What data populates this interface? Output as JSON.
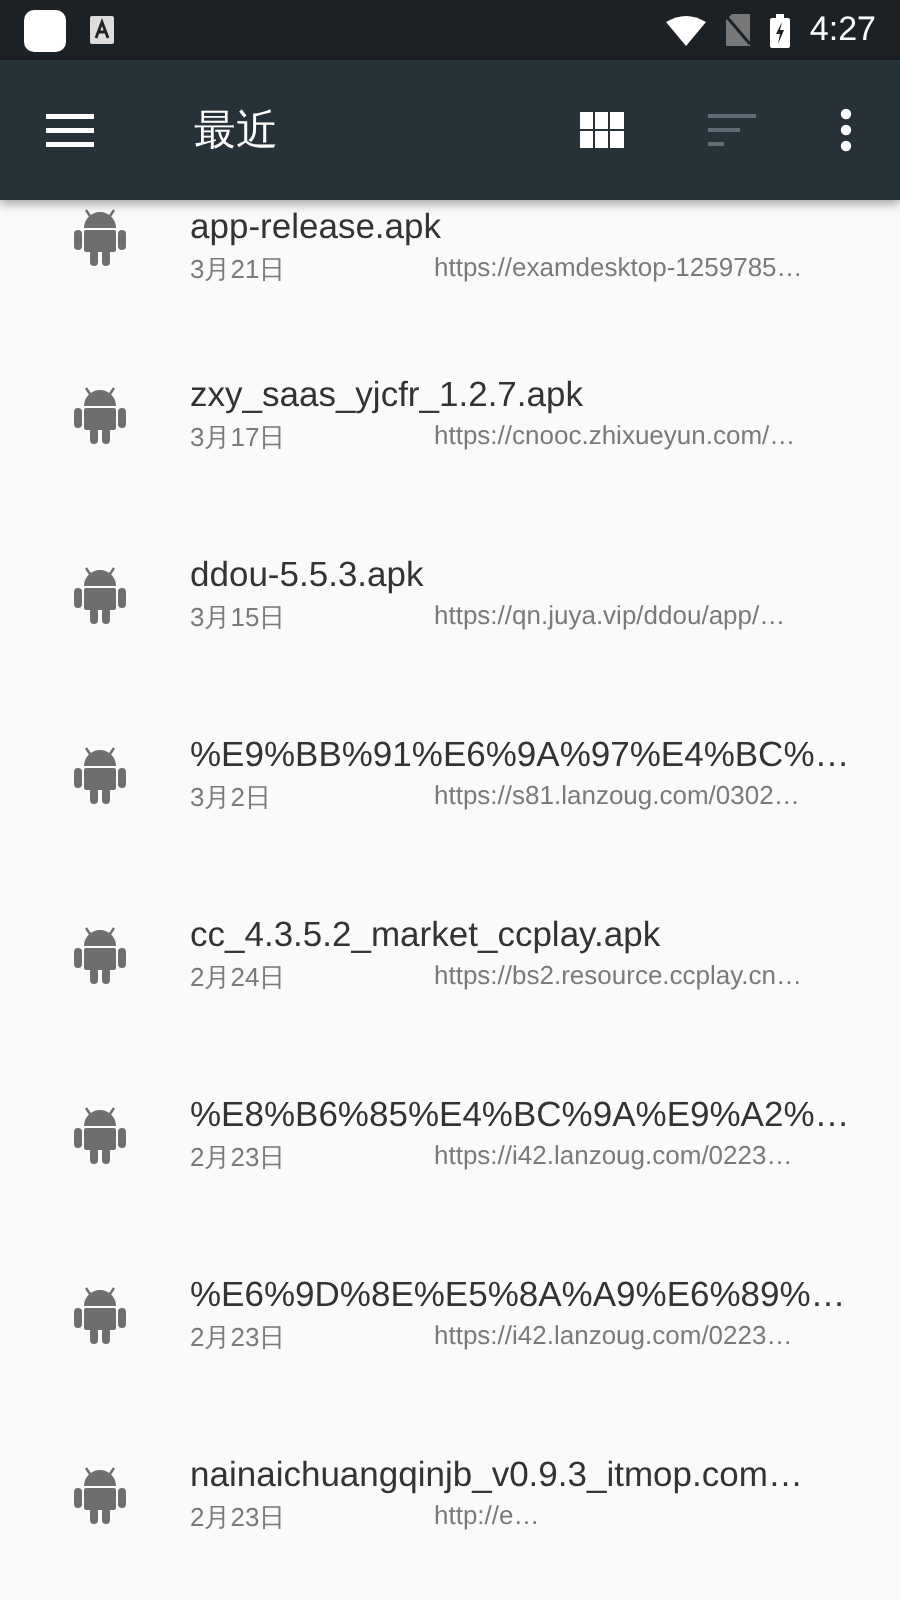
{
  "status_bar": {
    "time": "4:27"
  },
  "toolbar": {
    "title": "最近"
  },
  "files": [
    {
      "name": "app-release.apk",
      "date": "3月21日",
      "url": "https://examdesktop-1259785…"
    },
    {
      "name": "zxy_saas_yjcfr_1.2.7.apk",
      "date": "3月17日",
      "url": "https://cnooc.zhixueyun.com/…"
    },
    {
      "name": "ddou-5.5.3.apk",
      "date": "3月15日",
      "url": "https://qn.juya.vip/ddou/app/…"
    },
    {
      "name": "%E9%BB%91%E6%9A%97%E4%BC%…",
      "date": "3月2日",
      "url": "https://s81.lanzoug.com/0302…"
    },
    {
      "name": "cc_4.3.5.2_market_ccplay.apk",
      "date": "2月24日",
      "url": "https://bs2.resource.ccplay.cn…"
    },
    {
      "name": "%E8%B6%85%E4%BC%9A%E9%A2%…",
      "date": "2月23日",
      "url": "https://i42.lanzoug.com/0223…"
    },
    {
      "name": "%E6%9D%8E%E5%8A%A9%E6%89%…",
      "date": "2月23日",
      "url": "https://i42.lanzoug.com/0223…"
    },
    {
      "name": "nainaichuangqinjb_v0.9.3_itmop.com…",
      "date": "2月23日",
      "url": "http://e…"
    }
  ]
}
